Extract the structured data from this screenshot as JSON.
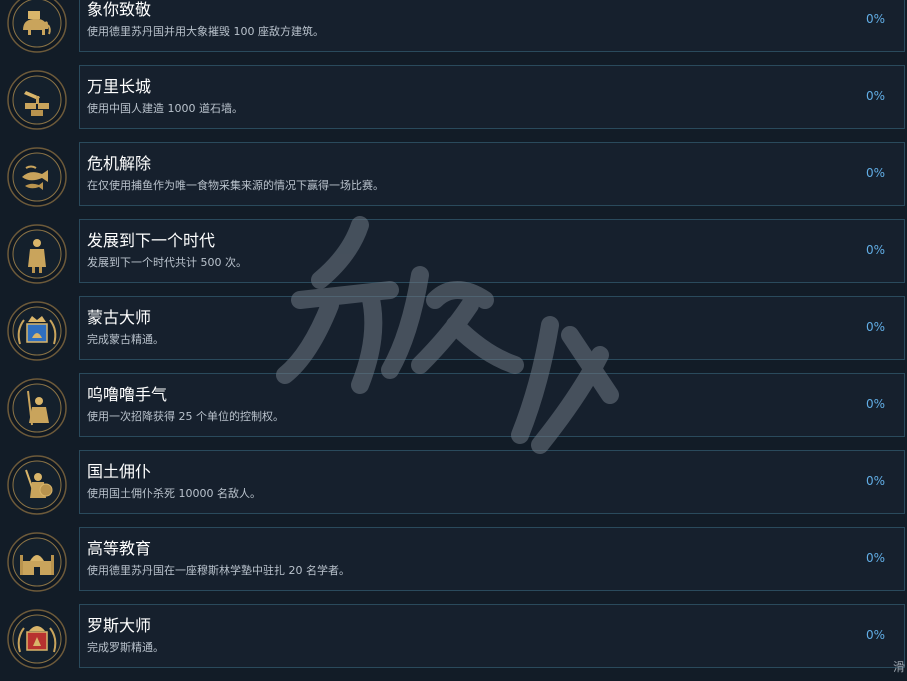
{
  "achievements": [
    {
      "title": "象你致敬",
      "description": "使用德里苏丹国并用大象摧毁 100 座敌方建筑。",
      "progress": "0%",
      "icon": "elephant-icon"
    },
    {
      "title": "万里长城",
      "description": "使用中国人建造 1000 道石墙。",
      "progress": "0%",
      "icon": "wall-icon"
    },
    {
      "title": "危机解除",
      "description": "在仅使用捕鱼作为唯一食物采集来源的情况下赢得一场比赛。",
      "progress": "0%",
      "icon": "fish-icon"
    },
    {
      "title": "发展到下一个时代",
      "description": "发展到下一个时代共计 500 次。",
      "progress": "0%",
      "icon": "villager-icon"
    },
    {
      "title": "蒙古大师",
      "description": "完成蒙古精通。",
      "progress": "0%",
      "icon": "mongol-emblem-icon"
    },
    {
      "title": "呜噜噜手气",
      "description": "使用一次招降获得 25 个单位的控制权。",
      "progress": "0%",
      "icon": "monk-icon"
    },
    {
      "title": "国土佣仆",
      "description": "使用国土佣仆杀死 10000 名敌人。",
      "progress": "0%",
      "icon": "swordsman-icon"
    },
    {
      "title": "高等教育",
      "description": "使用德里苏丹国在一座穆斯林学塾中驻扎 20 名学者。",
      "progress": "0%",
      "icon": "madrasa-icon"
    },
    {
      "title": "罗斯大师",
      "description": "完成罗斯精通。",
      "progress": "0%",
      "icon": "rus-emblem-icon"
    }
  ],
  "corner_text": "滑",
  "colors": {
    "background": "#121c27",
    "card": "#16202d",
    "card_border": "#2a4a5c",
    "progress": "#62aee6",
    "icon_gold": "#c9a45c"
  }
}
